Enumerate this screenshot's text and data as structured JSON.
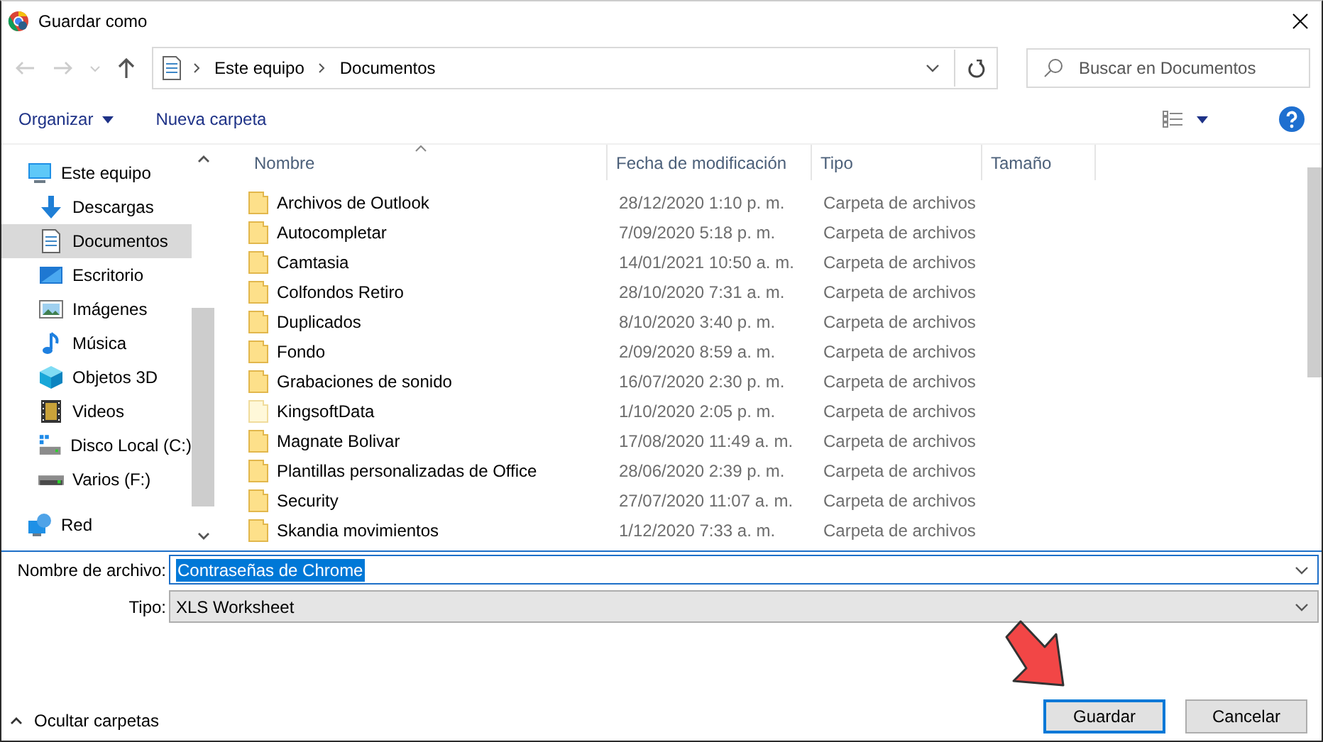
{
  "window": {
    "title": "Guardar como"
  },
  "nav": {
    "path": [
      "Este equipo",
      "Documentos"
    ],
    "search": {
      "placeholder": "Buscar en Documentos"
    }
  },
  "toolbar": {
    "organize": "Organizar",
    "new_folder": "Nueva carpeta"
  },
  "sidebar": {
    "items": [
      {
        "label": "Este equipo",
        "kind": "pc",
        "selected": false,
        "children": [
          {
            "label": "Descargas",
            "kind": "download",
            "selected": false
          },
          {
            "label": "Documentos",
            "kind": "document",
            "selected": true
          },
          {
            "label": "Escritorio",
            "kind": "desktop",
            "selected": false
          },
          {
            "label": "Imágenes",
            "kind": "pictures",
            "selected": false
          },
          {
            "label": "Música",
            "kind": "music",
            "selected": false
          },
          {
            "label": "Objetos 3D",
            "kind": "cube",
            "selected": false
          },
          {
            "label": "Videos",
            "kind": "video",
            "selected": false
          },
          {
            "label": "Disco Local (C:)",
            "kind": "system-drive",
            "selected": false
          },
          {
            "label": "Varios (F:)",
            "kind": "drive",
            "selected": false
          }
        ]
      },
      {
        "label": "Red",
        "kind": "network",
        "selected": false
      }
    ]
  },
  "table": {
    "columns": [
      "Nombre",
      "Fecha de modificación",
      "Tipo",
      "Tamaño"
    ],
    "rows": [
      {
        "name": "Archivos de Outlook",
        "date": "28/12/2020 1:10 p. m.",
        "type": "Carpeta de archivos",
        "kind": "folder"
      },
      {
        "name": "Autocompletar",
        "date": "7/09/2020 5:18 p. m.",
        "type": "Carpeta de archivos",
        "kind": "folder"
      },
      {
        "name": "Camtasia",
        "date": "14/01/2021 10:50 a. m.",
        "type": "Carpeta de archivos",
        "kind": "folder"
      },
      {
        "name": "Colfondos Retiro",
        "date": "28/10/2020 7:31 a. m.",
        "type": "Carpeta de archivos",
        "kind": "folder"
      },
      {
        "name": "Duplicados",
        "date": "8/10/2020 3:40 p. m.",
        "type": "Carpeta de archivos",
        "kind": "folder"
      },
      {
        "name": "Fondo",
        "date": "2/09/2020 8:59 a. m.",
        "type": "Carpeta de archivos",
        "kind": "folder"
      },
      {
        "name": "Grabaciones de sonido",
        "date": "16/07/2020 2:30 p. m.",
        "type": "Carpeta de archivos",
        "kind": "folder"
      },
      {
        "name": "KingsoftData",
        "date": "1/10/2020 2:05 p. m.",
        "type": "Carpeta de archivos",
        "kind": "hidden-folder"
      },
      {
        "name": "Magnate Bolivar",
        "date": "17/08/2020 11:49 a. m.",
        "type": "Carpeta de archivos",
        "kind": "folder"
      },
      {
        "name": "Plantillas personalizadas de Office",
        "date": "28/06/2020 2:39 p. m.",
        "type": "Carpeta de archivos",
        "kind": "folder"
      },
      {
        "name": "Security",
        "date": "27/07/2020 11:07 a. m.",
        "type": "Carpeta de archivos",
        "kind": "folder"
      },
      {
        "name": "Skandia movimientos",
        "date": "1/12/2020 7:33 a. m.",
        "type": "Carpeta de archivos",
        "kind": "folder"
      }
    ]
  },
  "form": {
    "filename_label": "Nombre de archivo:",
    "filename": "Contraseñas de Chrome",
    "type_label": "Tipo:",
    "type": "XLS Worksheet"
  },
  "footer": {
    "toggle": "Ocultar carpetas",
    "buttons": [
      {
        "label": "Guardar",
        "default": true
      },
      {
        "label": "Cancelar",
        "default": false
      }
    ]
  }
}
